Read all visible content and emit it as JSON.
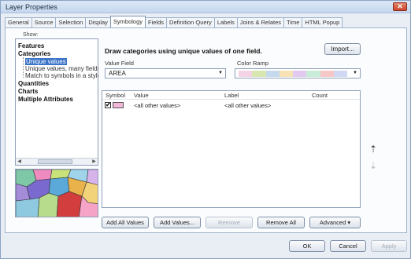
{
  "window": {
    "title": "Layer Properties"
  },
  "tabs": [
    {
      "label": "General"
    },
    {
      "label": "Source"
    },
    {
      "label": "Selection"
    },
    {
      "label": "Display"
    },
    {
      "label": "Symbology",
      "active": true
    },
    {
      "label": "Fields"
    },
    {
      "label": "Definition Query"
    },
    {
      "label": "Labels"
    },
    {
      "label": "Joins & Relates"
    },
    {
      "label": "Time"
    },
    {
      "label": "HTML Popup"
    }
  ],
  "show": {
    "label": "Show:",
    "items": [
      {
        "label": "Features",
        "bold": true
      },
      {
        "label": "Categories",
        "bold": true
      },
      {
        "label": "Unique values",
        "selected": true
      },
      {
        "label": "Unique values, many fields"
      },
      {
        "label": "Match to symbols in a style"
      },
      {
        "label": "Quantities",
        "bold": true
      },
      {
        "label": "Charts",
        "bold": true
      },
      {
        "label": "Multiple Attributes",
        "bold": true
      }
    ]
  },
  "heading": "Draw categories using unique values of one field.",
  "import_label": "Import...",
  "value_field": {
    "label": "Value Field",
    "value": "AREA"
  },
  "color_ramp": {
    "label": "Color Ramp",
    "colors": [
      "#f3d3e4",
      "#d8e6b0",
      "#c4d9ee",
      "#f6e2b4",
      "#e2c9ef",
      "#c8ecd8",
      "#f7c6c6",
      "#d0d8f4"
    ]
  },
  "table": {
    "headers": [
      "Symbol",
      "Value",
      "Label",
      "Count"
    ],
    "rows": [
      {
        "checked": "✔",
        "value": "<all other values>",
        "label": "<all other values>",
        "count": ""
      }
    ]
  },
  "icons": {
    "up": "up-arrow-icon",
    "down": "down-arrow-icon"
  },
  "buttons": {
    "add_all": "Add All Values",
    "add_values": "Add Values...",
    "remove": "Remove",
    "remove_all": "Remove All",
    "advanced": "Advanced",
    "ok": "OK",
    "cancel": "Cancel",
    "apply": "Apply"
  }
}
